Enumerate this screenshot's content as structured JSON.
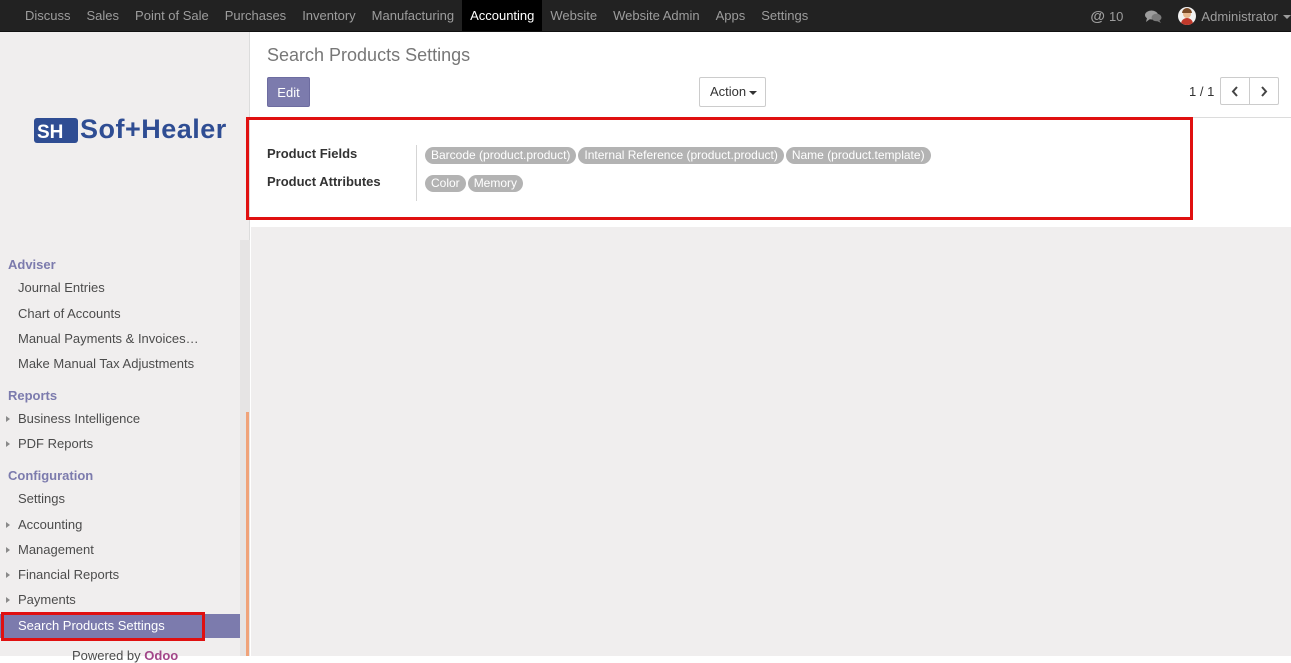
{
  "topbar": {
    "menu": [
      {
        "label": "Discuss",
        "active": false
      },
      {
        "label": "Sales",
        "active": false
      },
      {
        "label": "Point of Sale",
        "active": false
      },
      {
        "label": "Purchases",
        "active": false
      },
      {
        "label": "Inventory",
        "active": false
      },
      {
        "label": "Manufacturing",
        "active": false
      },
      {
        "label": "Accounting",
        "active": true
      },
      {
        "label": "Website",
        "active": false
      },
      {
        "label": "Website Admin",
        "active": false
      },
      {
        "label": "Apps",
        "active": false
      },
      {
        "label": "Settings",
        "active": false
      }
    ],
    "mention_symbol": "@",
    "mention_count": "10",
    "chat_icon": "comments-icon",
    "user_name": "Administrator"
  },
  "sidebar": {
    "logo_text": "Sof+Healer",
    "logo_mark": "SH",
    "sections": {
      "adviser": "Adviser",
      "reports": "Reports",
      "configuration": "Configuration"
    },
    "adviser_items": [
      "Journal Entries",
      "Chart of Accounts",
      "Manual Payments & Invoices…",
      "Make Manual Tax Adjustments"
    ],
    "reports_items": [
      "Business Intelligence",
      "PDF Reports"
    ],
    "configuration_items": [
      "Settings",
      "Accounting",
      "Management",
      "Financial Reports",
      "Payments",
      "Search Products Settings"
    ],
    "powered_prefix": "Powered by ",
    "powered_brand": "Odoo"
  },
  "main": {
    "title": "Search Products Settings",
    "edit_label": "Edit",
    "action_label": "Action",
    "pager": "1 / 1",
    "form": {
      "product_fields_label": "Product Fields",
      "product_fields_tags": [
        "Barcode (product.product)",
        "Internal Reference (product.product)",
        "Name (product.template)"
      ],
      "product_attributes_label": "Product Attributes",
      "product_attributes_tags": [
        "Color",
        "Memory"
      ]
    }
  },
  "colors": {
    "navbar": "#222222",
    "accent": "#7c7bad",
    "highlight_box": "#e01010",
    "tag": "#b3b3b3"
  }
}
